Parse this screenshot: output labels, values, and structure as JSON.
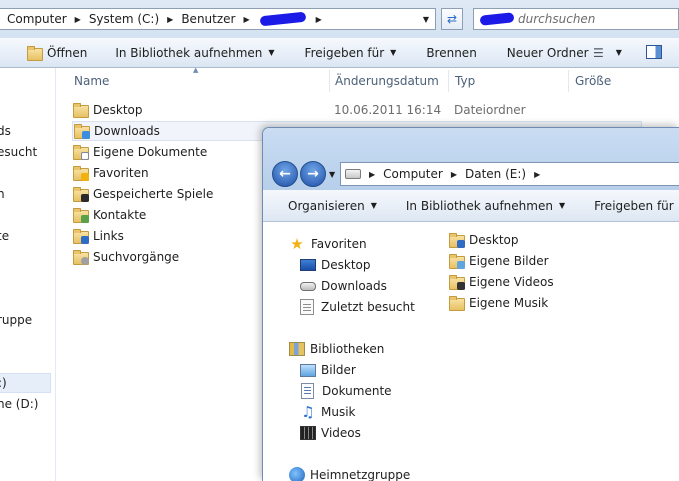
{
  "back_window": {
    "breadcrumbs": [
      "Computer",
      "System (C:)",
      "Benutzer"
    ],
    "search_placeholder": "durchsuchen",
    "toolbar": {
      "open": "Öffnen",
      "include_library": "In Bibliothek aufnehmen",
      "share": "Freigeben für",
      "burn": "Brennen",
      "new_folder": "Neuer Ordner"
    },
    "columns": {
      "name": "Name",
      "modified": "Änderungsdatum",
      "type": "Typ",
      "size": "Größe"
    },
    "nav_fragments": [
      "ds",
      "esucht",
      "n",
      "te",
      "ruppe",
      ":)",
      "ne (D:)"
    ],
    "files": [
      {
        "name": "Desktop",
        "date": "10.06.2011 16:14",
        "type": "Dateiordner"
      },
      {
        "name": "Downloads",
        "date": "",
        "type": ""
      },
      {
        "name": "Eigene Dokumente",
        "date": "",
        "type": ""
      },
      {
        "name": "Favoriten",
        "date": "",
        "type": ""
      },
      {
        "name": "Gespeicherte Spiele",
        "date": "",
        "type": ""
      },
      {
        "name": "Kontakte",
        "date": "",
        "type": ""
      },
      {
        "name": "Links",
        "date": "",
        "type": ""
      },
      {
        "name": "Suchvorgänge",
        "date": "",
        "type": ""
      }
    ]
  },
  "front_window": {
    "breadcrumbs": [
      "Computer",
      "Daten (E:)"
    ],
    "toolbar": {
      "organize": "Organisieren",
      "include_library": "In Bibliothek aufnehmen",
      "share": "Freigeben für"
    },
    "nav": {
      "favorites": "Favoriten",
      "desktop": "Desktop",
      "downloads": "Downloads",
      "recent": "Zuletzt besucht",
      "libraries": "Bibliotheken",
      "pictures": "Bilder",
      "documents": "Dokumente",
      "music": "Musik",
      "videos": "Videos",
      "homegroup": "Heimnetzgruppe"
    },
    "files": [
      "Desktop",
      "Eigene Bilder",
      "Eigene Videos",
      "Eigene Musik"
    ]
  }
}
